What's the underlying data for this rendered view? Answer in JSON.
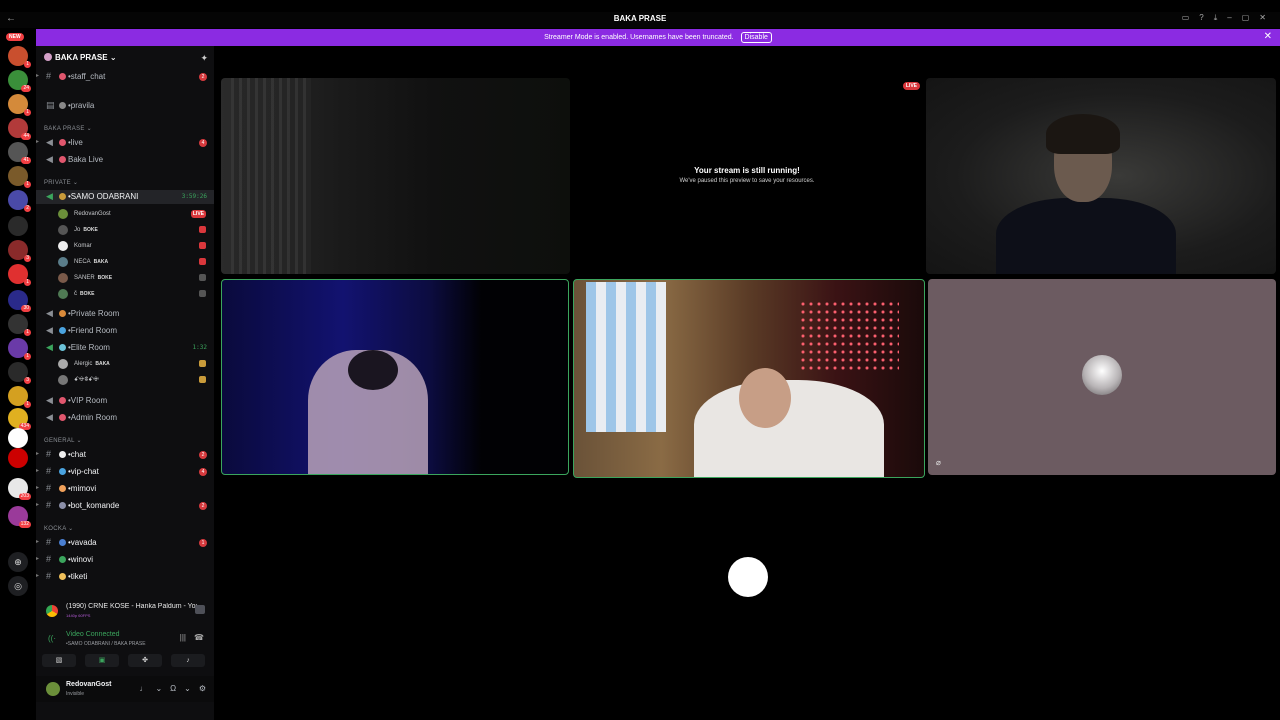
{
  "window": {
    "title": "BAKA PRASE",
    "back_label": "←",
    "controls": [
      "▭",
      "?",
      "⤓",
      "–",
      "▢",
      "✕"
    ]
  },
  "banner": {
    "message": "Streamer Mode is enabled. Usernames have been truncated.",
    "disable_label": "Disable",
    "close_icon": "✕"
  },
  "servers": {
    "new_label": "NEW",
    "badges": [
      "1",
      "24",
      "1",
      "44",
      "41",
      "1",
      "2",
      "",
      "3",
      "1",
      "30",
      "1",
      "1",
      "3",
      "1",
      "434",
      "",
      "",
      "203",
      "132"
    ]
  },
  "sidebar": {
    "server_name": "BAKA PRASE",
    "server_chevron": "⌄",
    "invite_icon": "✦",
    "channels_top": [
      {
        "label": "•staff_chat",
        "count": "2",
        "type": "text"
      },
      {
        "label": "•pravila",
        "type": "rules"
      }
    ],
    "categories": {
      "baka": "BAKA PRASE ⌄",
      "private": "PRIVATE ⌄",
      "general": "GENERAL ⌄",
      "kocka": "KOCKA ⌄"
    },
    "baka_channels": [
      {
        "label": "•live",
        "count": "4"
      },
      {
        "label": "Baka Live"
      }
    ],
    "samo": {
      "label": "•SAMO ODABRANI",
      "timer": "3:59:26"
    },
    "samo_users": [
      {
        "name": "RedovanGost",
        "tag": "",
        "indicator": "LIVE"
      },
      {
        "name": "Jo",
        "tag": "BOKE"
      },
      {
        "name": "Komar",
        "tag": ""
      },
      {
        "name": "NECA",
        "tag": "BAKA"
      },
      {
        "name": "SANER",
        "tag": "BOKE"
      },
      {
        "name": "č",
        "tag": "BOKE"
      }
    ],
    "voice_rooms": [
      {
        "label": "•Private Room"
      },
      {
        "label": "•Friend Room"
      }
    ],
    "elite": {
      "label": "•Elite Room",
      "timer": "1:32"
    },
    "elite_users": [
      {
        "name": "Alergic",
        "tag": "BAKA"
      },
      {
        "name": "ꗃꗳꗊꗃꗴ",
        "tag": ""
      }
    ],
    "more_rooms": [
      {
        "label": "•VIP Room"
      },
      {
        "label": "•Admin Room"
      }
    ],
    "general_channels": [
      {
        "label": "•chat",
        "count": "2"
      },
      {
        "label": "•vip-chat",
        "count": "4"
      },
      {
        "label": "•mimovi"
      },
      {
        "label": "•bot_komande",
        "count": "2"
      }
    ],
    "kocka_channels": [
      {
        "label": "•vavada",
        "count": "1"
      },
      {
        "label": "•winovi"
      },
      {
        "label": "•tiketi"
      }
    ],
    "activity": {
      "title": "(1990) CRNE KOSE - Hanka Paldum - YouTu...",
      "subtitle": "1440p 60FPS"
    },
    "voice": {
      "status": "Video Connected",
      "channel": "•SAMO ODABRANI / BAKA PRASE"
    },
    "voice_buttons": [
      "camera-off",
      "screen-share",
      "activities",
      "soundboard"
    ],
    "user": {
      "name": "RedovanGost",
      "status": "Invisible"
    }
  },
  "stage": {
    "paused_title": "Your stream is still running!",
    "paused_sub": "We've paused this preview to save your resources.",
    "live_badge": "LIVE"
  },
  "colors": {
    "accent": "#8b2be2",
    "live": "#da373c",
    "connected": "#3ba55d"
  }
}
